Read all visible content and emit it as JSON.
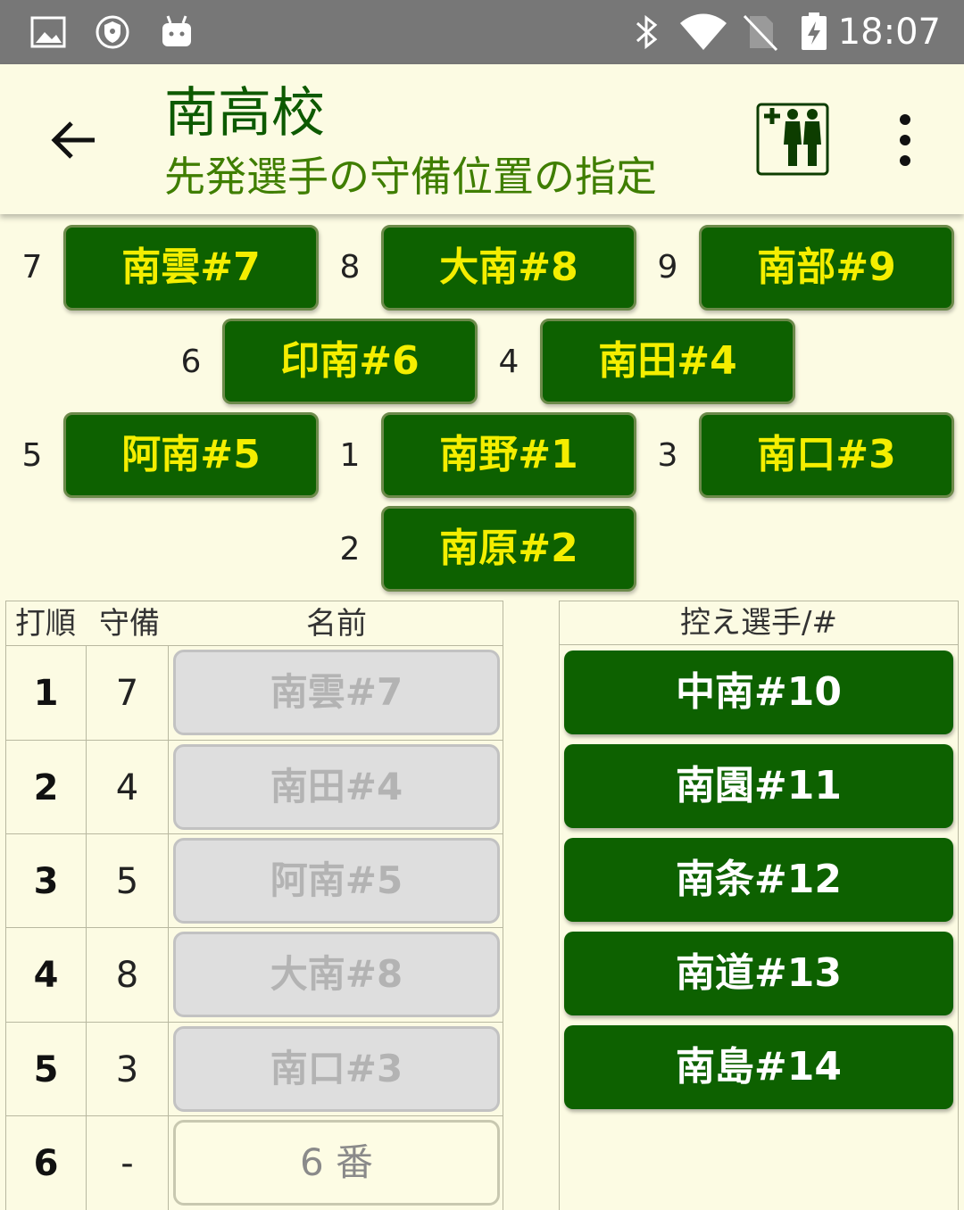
{
  "status_bar": {
    "time": "18:07",
    "left_icons": [
      "image-icon",
      "vpn-shield-icon",
      "android-icon"
    ],
    "right_icons": [
      "bluetooth-icon",
      "wifi-icon",
      "no-sim-icon",
      "battery-charging-icon"
    ]
  },
  "app_bar": {
    "title": "南高校",
    "subtitle": "先発選手の守備位置の指定"
  },
  "field": {
    "positions": [
      {
        "num": "7",
        "label": "南雲#7"
      },
      {
        "num": "8",
        "label": "大南#8"
      },
      {
        "num": "9",
        "label": "南部#9"
      },
      {
        "num": "6",
        "label": "印南#6"
      },
      {
        "num": "4",
        "label": "南田#4"
      },
      {
        "num": "5",
        "label": "阿南#5"
      },
      {
        "num": "1",
        "label": "南野#1"
      },
      {
        "num": "3",
        "label": "南口#3"
      },
      {
        "num": "2",
        "label": "南原#2"
      }
    ]
  },
  "lineup": {
    "headers": {
      "order": "打順",
      "position": "守備",
      "name": "名前"
    },
    "rows": [
      {
        "order": "1",
        "position": "7",
        "name": "南雲#7"
      },
      {
        "order": "2",
        "position": "4",
        "name": "南田#4"
      },
      {
        "order": "3",
        "position": "5",
        "name": "阿南#5"
      },
      {
        "order": "4",
        "position": "8",
        "name": "大南#8"
      },
      {
        "order": "5",
        "position": "3",
        "name": "南口#3"
      },
      {
        "order": "6",
        "position": "-",
        "name": "6 番"
      }
    ]
  },
  "bench": {
    "header": "控え選手/#",
    "players": [
      "中南#10",
      "南園#11",
      "南条#12",
      "南道#13",
      "南島#14"
    ]
  },
  "colors": {
    "background": "#fcfbe3",
    "button_green": "#0d6100",
    "button_text_yellow": "#f4ee00",
    "title_green": "#0d5a00",
    "disabled_gray": "#dedede",
    "status_bar": "#777777"
  }
}
